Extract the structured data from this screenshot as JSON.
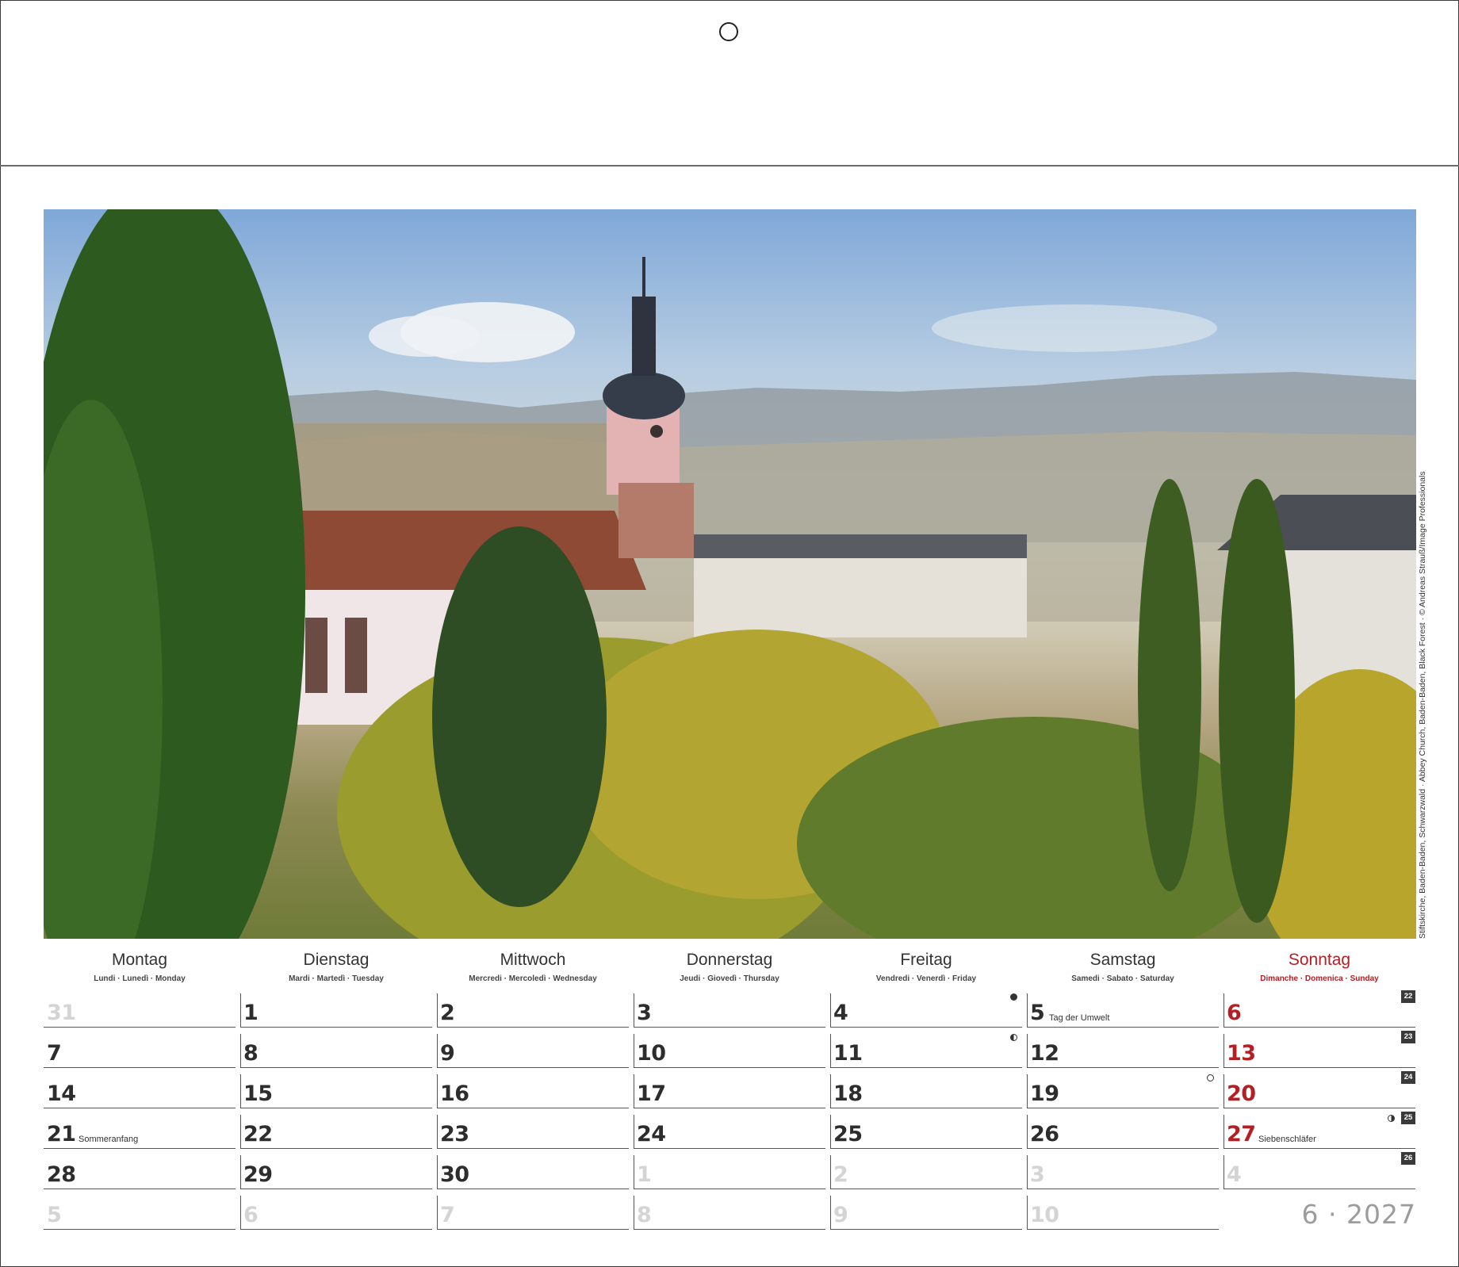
{
  "calendar": {
    "month_label": "6 · 2027",
    "photo_credit": "Stiftskirche, Baden-Baden, Schwarzwald · Abbey Church, Baden-Baden, Black Forest · © Andreas Strauß/Image Professionals",
    "weekdays": [
      {
        "name": "Montag",
        "sub": "Lundi · Lunedì · Monday"
      },
      {
        "name": "Dienstag",
        "sub": "Mardi · Martedì · Tuesday"
      },
      {
        "name": "Mittwoch",
        "sub": "Mercredi · Mercoledì · Wednesday"
      },
      {
        "name": "Donnerstag",
        "sub": "Jeudi · Giovedì · Thursday"
      },
      {
        "name": "Freitag",
        "sub": "Vendredi · Venerdì · Friday"
      },
      {
        "name": "Samstag",
        "sub": "Samedi · Sabato · Saturday"
      },
      {
        "name": "Sonntag",
        "sub": "Dimanche · Domenica · Sunday"
      }
    ],
    "weeks": [
      {
        "kw": "22",
        "days": [
          {
            "n": "31",
            "muted": true
          },
          {
            "n": "1"
          },
          {
            "n": "2"
          },
          {
            "n": "3"
          },
          {
            "n": "4",
            "moon": "full"
          },
          {
            "n": "5",
            "note": "Tag der Umwelt"
          },
          {
            "n": "6",
            "sunday": true
          }
        ]
      },
      {
        "kw": "23",
        "days": [
          {
            "n": "7"
          },
          {
            "n": "8"
          },
          {
            "n": "9"
          },
          {
            "n": "10"
          },
          {
            "n": "11",
            "moon": "half-last"
          },
          {
            "n": "12"
          },
          {
            "n": "13",
            "sunday": true
          }
        ]
      },
      {
        "kw": "24",
        "days": [
          {
            "n": "14"
          },
          {
            "n": "15"
          },
          {
            "n": "16"
          },
          {
            "n": "17"
          },
          {
            "n": "18"
          },
          {
            "n": "19",
            "moon": "new"
          },
          {
            "n": "20",
            "sunday": true
          }
        ]
      },
      {
        "kw": "25",
        "days": [
          {
            "n": "21",
            "note": "Sommeranfang"
          },
          {
            "n": "22"
          },
          {
            "n": "23"
          },
          {
            "n": "24"
          },
          {
            "n": "25"
          },
          {
            "n": "26"
          },
          {
            "n": "27",
            "sunday": true,
            "note": "Siebenschläfer",
            "moon": "half-first"
          }
        ]
      },
      {
        "kw": "26",
        "days": [
          {
            "n": "28"
          },
          {
            "n": "29"
          },
          {
            "n": "30"
          },
          {
            "n": "1",
            "muted": true
          },
          {
            "n": "2",
            "muted": true
          },
          {
            "n": "3",
            "muted": true
          },
          {
            "n": "4",
            "muted": true
          }
        ]
      },
      {
        "kw": "",
        "days": [
          {
            "n": "5",
            "muted": true
          },
          {
            "n": "6",
            "muted": true
          },
          {
            "n": "7",
            "muted": true
          },
          {
            "n": "8",
            "muted": true
          },
          {
            "n": "9",
            "muted": true
          },
          {
            "n": "10",
            "muted": true
          }
        ]
      }
    ]
  }
}
